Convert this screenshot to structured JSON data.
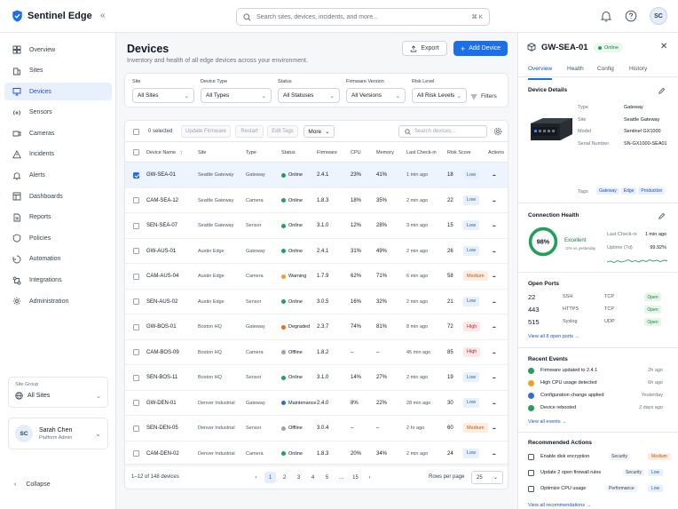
{
  "app": {
    "name": "Sentinel Edge"
  },
  "search": {
    "placeholder": "Search sites, devices, incidents, and more...",
    "shortcut": "⌘ K"
  },
  "user": {
    "initials": "SC",
    "name": "Sarah Chen",
    "role": "Platform Admin"
  },
  "sidebar": {
    "items": [
      {
        "label": "Overview",
        "icon": "grid-icon"
      },
      {
        "label": "Sites",
        "icon": "building-icon"
      },
      {
        "label": "Devices",
        "icon": "monitor-icon"
      },
      {
        "label": "Sensors",
        "icon": "sensor-icon"
      },
      {
        "label": "Cameras",
        "icon": "camera-icon"
      },
      {
        "label": "Incidents",
        "icon": "alert-triangle-icon"
      },
      {
        "label": "Alerts",
        "icon": "bell-icon"
      },
      {
        "label": "Dashboards",
        "icon": "dashboard-icon"
      },
      {
        "label": "Reports",
        "icon": "file-icon"
      },
      {
        "label": "Policies",
        "icon": "shield-icon"
      },
      {
        "label": "Automation",
        "icon": "automation-icon"
      },
      {
        "label": "Integrations",
        "icon": "integrations-icon"
      },
      {
        "label": "Administration",
        "icon": "gear-icon"
      }
    ],
    "site_group_label": "Site Group",
    "site_group_value": "All Sites",
    "collapse": "Collapse"
  },
  "page": {
    "title": "Devices",
    "subtitle": "Inventory and health of all edge devices across your environment.",
    "export": "Export",
    "add": "Add Device"
  },
  "filters": {
    "items": [
      {
        "label": "Site",
        "value": "All Sites"
      },
      {
        "label": "Device Type",
        "value": "All Types"
      },
      {
        "label": "Status",
        "value": "All Statuses"
      },
      {
        "label": "Firmware Version",
        "value": "All Versions"
      },
      {
        "label": "Risk Level",
        "value": "All Risk Levels"
      }
    ],
    "button": "Filters"
  },
  "toolbar": {
    "selected": "0 selected",
    "update_firmware": "Update Firmware",
    "restart": "Restart",
    "edit_tags": "Edit Tags",
    "more": "More",
    "search_placeholder": "Search devices..."
  },
  "table": {
    "columns": [
      "Device Name",
      "Site",
      "Type",
      "Status",
      "Firmware",
      "CPU",
      "Memory",
      "Last Check-in",
      "Risk Score",
      "Actions"
    ],
    "rows": [
      {
        "name": "GW-SEA-01",
        "site": "Seattle Gateway",
        "type": "Gateway",
        "status": "Online",
        "fw": "2.4.1",
        "cpu": "23%",
        "mem": "41%",
        "checkin": "1 min ago",
        "score": "18",
        "risk": "Low",
        "selected": true
      },
      {
        "name": "CAM-SEA-12",
        "site": "Seattle Gateway",
        "type": "Camera",
        "status": "Online",
        "fw": "1.8.3",
        "cpu": "18%",
        "mem": "35%",
        "checkin": "2 min ago",
        "score": "22",
        "risk": "Low"
      },
      {
        "name": "SEN-SEA-07",
        "site": "Seattle Gateway",
        "type": "Sensor",
        "status": "Online",
        "fw": "3.1.0",
        "cpu": "12%",
        "mem": "28%",
        "checkin": "3 min ago",
        "score": "15",
        "risk": "Low"
      },
      {
        "name": "GW-AUS-01",
        "site": "Austin Edge",
        "type": "Gateway",
        "status": "Online",
        "fw": "2.4.1",
        "cpu": "31%",
        "mem": "49%",
        "checkin": "2 min ago",
        "score": "26",
        "risk": "Low"
      },
      {
        "name": "CAM-AUS-04",
        "site": "Austin Edge",
        "type": "Camera",
        "status": "Warning",
        "fw": "1.7.9",
        "cpu": "62%",
        "mem": "71%",
        "checkin": "6 min ago",
        "score": "58",
        "risk": "Medium"
      },
      {
        "name": "SEN-AUS-02",
        "site": "Austin Edge",
        "type": "Sensor",
        "status": "Online",
        "fw": "3.0.5",
        "cpu": "16%",
        "mem": "32%",
        "checkin": "2 min ago",
        "score": "21",
        "risk": "Low"
      },
      {
        "name": "GW-BOS-01",
        "site": "Boston HQ",
        "type": "Gateway",
        "status": "Degraded",
        "fw": "2.3.7",
        "cpu": "74%",
        "mem": "81%",
        "checkin": "8 min ago",
        "score": "72",
        "risk": "High"
      },
      {
        "name": "CAM-BOS-09",
        "site": "Boston HQ",
        "type": "Camera",
        "status": "Offline",
        "fw": "1.8.2",
        "cpu": "–",
        "mem": "–",
        "checkin": "45 min ago",
        "score": "85",
        "risk": "High"
      },
      {
        "name": "SEN-BOS-11",
        "site": "Boston HQ",
        "type": "Sensor",
        "status": "Online",
        "fw": "3.1.0",
        "cpu": "14%",
        "mem": "27%",
        "checkin": "2 min ago",
        "score": "19",
        "risk": "Low"
      },
      {
        "name": "GW-DEN-01",
        "site": "Denver Industrial",
        "type": "Gateway",
        "status": "Maintenance",
        "fw": "2.4.0",
        "cpu": "8%",
        "mem": "22%",
        "checkin": "28 min ago",
        "score": "30",
        "risk": "Low"
      },
      {
        "name": "SEN-DEN-05",
        "site": "Denver Industrial",
        "type": "Sensor",
        "status": "Offline",
        "fw": "3.0.4",
        "cpu": "–",
        "mem": "–",
        "checkin": "2 hr ago",
        "score": "60",
        "risk": "Medium"
      },
      {
        "name": "CAM-DEN-02",
        "site": "Denver Industrial",
        "type": "Camera",
        "status": "Online",
        "fw": "1.8.3",
        "cpu": "20%",
        "mem": "34%",
        "checkin": "2 min ago",
        "score": "24",
        "risk": "Low"
      }
    ]
  },
  "status_colors": {
    "Online": "#22a05a",
    "Warning": "#f0a020",
    "Degraded": "#ef6c1a",
    "Offline": "#9ca3af",
    "Maintenance": "#2b6fdc"
  },
  "pagination": {
    "summary": "1–12 of 148 devices",
    "pages": [
      "1",
      "2",
      "3",
      "4",
      "5",
      "…",
      "15"
    ],
    "rows_per_page_label": "Rows per page",
    "rows_per_page": "25"
  },
  "detail": {
    "title": "GW-SEA-01",
    "status": "Online",
    "tabs": [
      "Overview",
      "Health",
      "Config",
      "History"
    ],
    "device_details_title": "Device Details",
    "details": [
      {
        "k": "Type",
        "v": "Gateway"
      },
      {
        "k": "Site",
        "v": "Seattle Gateway"
      },
      {
        "k": "Model",
        "v": "Sentinel GX1000"
      },
      {
        "k": "Serial Number",
        "v": "SN-GX1000-SEA01"
      }
    ],
    "tags_label": "Tags",
    "tags": [
      "Gateway",
      "Edge",
      "Production"
    ],
    "health_title": "Connection Health",
    "health_value": 98,
    "health_pct": "98%",
    "health_label": "Excellent",
    "health_change": "↑2% vs yesterday",
    "last_checkin_label": "Last Check-in",
    "last_checkin": "1 min ago",
    "uptime_label": "Uptime (7d)",
    "uptime": "99.92%",
    "ports_title": "Open Ports",
    "ports": [
      {
        "port": "22",
        "svc": "SSH",
        "proto": "TCP",
        "state": "Open"
      },
      {
        "port": "443",
        "svc": "HTTPS",
        "proto": "TCP",
        "state": "Open"
      },
      {
        "port": "515",
        "svc": "Syslog",
        "proto": "UDP",
        "state": "Open"
      }
    ],
    "ports_link": "View all 8 open ports",
    "events_title": "Recent Events",
    "events": [
      {
        "text": "Firmware updated to 2.4.1",
        "time": "2h ago",
        "color": "#22a05a"
      },
      {
        "text": "High CPU usage detected",
        "time": "6h ago",
        "color": "#f0a020"
      },
      {
        "text": "Configuration change applied",
        "time": "Yesterday",
        "color": "#2b6fdc"
      },
      {
        "text": "Device rebooted",
        "time": "2 days ago",
        "color": "#22a05a"
      }
    ],
    "events_link": "View all events",
    "rec_title": "Recommended Actions",
    "recs": [
      {
        "text": "Enable disk encryption",
        "cat": "Security",
        "pri": "Medium"
      },
      {
        "text": "Update 2 open firewall rules",
        "cat": "Security",
        "pri": "Low"
      },
      {
        "text": "Optimize CPU usage",
        "cat": "Performance",
        "pri": "Low"
      }
    ],
    "rec_link": "View all recommendations"
  }
}
